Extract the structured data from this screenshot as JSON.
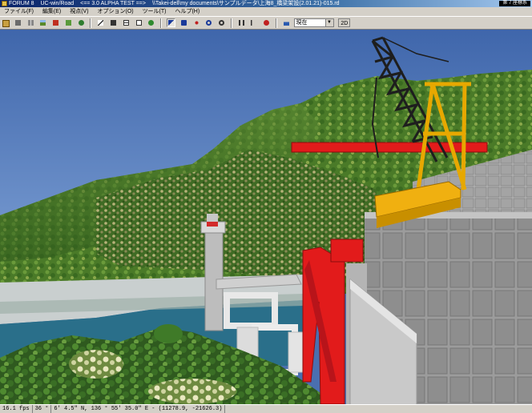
{
  "window": {
    "app_name": "FORUM 8",
    "product": "UC-win/Road",
    "version_tag": "<== 3.0 ALPHA TEST ==>",
    "file_path": "\\\\Takei-dell\\my documents\\サンプルデータ\\上海8_橋梁架設(2.01.21)-015.rd",
    "view_badge": "第 7 座標系"
  },
  "menu": [
    {
      "label": "ファイル(F)"
    },
    {
      "label": "編集(E)"
    },
    {
      "label": "視点(V)"
    },
    {
      "label": "オプション(O)"
    },
    {
      "label": "ツール(T)"
    },
    {
      "label": "ヘルプ(H)"
    }
  ],
  "toolbar": {
    "groups": [
      [
        "open-icon",
        "road-icon",
        "intersection-icon",
        "terrain-icon",
        "model-icon",
        "texture-icon",
        "tree-icon"
      ],
      [
        "pen-icon",
        "measure-icon",
        "grid-icon",
        "table-icon",
        "sign-icon"
      ],
      [
        "pointer-icon",
        "camera-icon",
        "move-icon",
        "rotate-icon",
        "zoom-icon"
      ],
      [
        "pause-icon",
        "step-icon",
        "record-icon"
      ],
      [
        "car-icon"
      ]
    ],
    "view_select_value": "現在",
    "mode_button_label": "2D"
  },
  "scene": {
    "sky_color": "#4a70b4",
    "hill_color": "#4c7a2c",
    "crane_boom_color": "#222222",
    "crane_body_color": "#e7a800",
    "red_beam_color": "#e21b1b",
    "concrete_color": "#9a9a9a"
  },
  "status": {
    "fps": "16.1 fps",
    "heading": "36 °",
    "coords": "6' 4.5\" N, 136 °  55' 35.0\" E  -  (11278.9, -21626.3)"
  }
}
